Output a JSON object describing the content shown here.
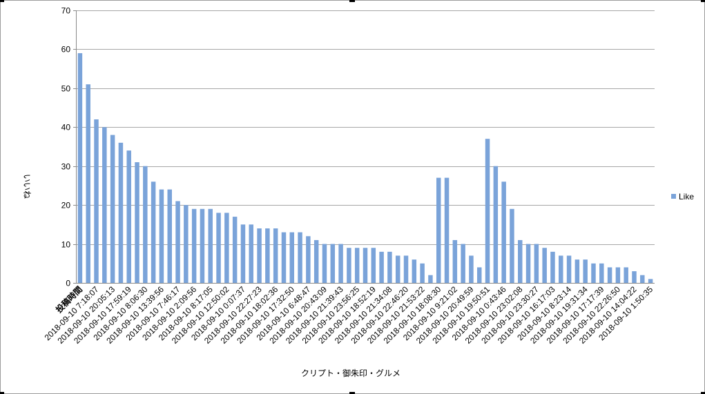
{
  "chart_data": {
    "type": "bar",
    "ylabel": "いいね",
    "xlabel": "クリプト・御朱印・グルメ",
    "ylim": [
      0,
      70
    ],
    "yticks": [
      0,
      10,
      20,
      30,
      40,
      50,
      60,
      70
    ],
    "grid": true,
    "legend_position": "right",
    "bar_color": "#7aa3d9",
    "tick_labels": [
      "投稿時間",
      "2018-09-10 7:18:07",
      "2018-09-10 20:05:13",
      "2018-09-10 17:59:19",
      "2018-09-10 8:06:30",
      "2018-09-10 13:39:56",
      "2018-09-10 7:46:17",
      "2018-09-10 2:09:56",
      "2018-09-10 8:17:05",
      "2018-09-10 12:50:02",
      "2018-09-10 0:07:37",
      "2018-09-10 22:27:23",
      "2018-09-10 18:02:36",
      "2018-09-10 17:32:50",
      "2018-09-10 6:48:47",
      "2018-09-10 20:43:09",
      "2018-09-10 21:39:43",
      "2018-09-10 23:56:25",
      "2018-09-10 18:52:19",
      "2018-09-10 21:34:08",
      "2018-09-10 22:46:20",
      "2018-09-10 21:53:22",
      "2018-09-10 18:08:30",
      "2018-09-10 9:21:02",
      "2018-09-10 20:49:59",
      "2018-09-10 19:50:51",
      "2018-09-10 0:43:46",
      "2018-09-10 23:02:08",
      "2018-09-10 23:30:27",
      "2018-09-10 16:17:03",
      "2018-09-10 8:23:14",
      "2018-09-10 19:31:34",
      "2018-09-10 17:17:39",
      "2018-09-10 22:26:50",
      "2018-09-10 14:04:22",
      "2018-09-10 1:50:35"
    ],
    "series": [
      {
        "name": "Like",
        "values": [
          59,
          51,
          42,
          40,
          38,
          36,
          34,
          31,
          30,
          26,
          24,
          24,
          21,
          20,
          19,
          19,
          19,
          18,
          18,
          17,
          15,
          15,
          14,
          14,
          14,
          13,
          13,
          13,
          12,
          11,
          10,
          10,
          10,
          9,
          9,
          9,
          9,
          8,
          8,
          7,
          7,
          6,
          5,
          2,
          27,
          27,
          11,
          10,
          7,
          4,
          37,
          30,
          26,
          19,
          11,
          10,
          10,
          9,
          8,
          7,
          7,
          6,
          6,
          5,
          5,
          4,
          4,
          4,
          3,
          2,
          1
        ]
      }
    ]
  }
}
